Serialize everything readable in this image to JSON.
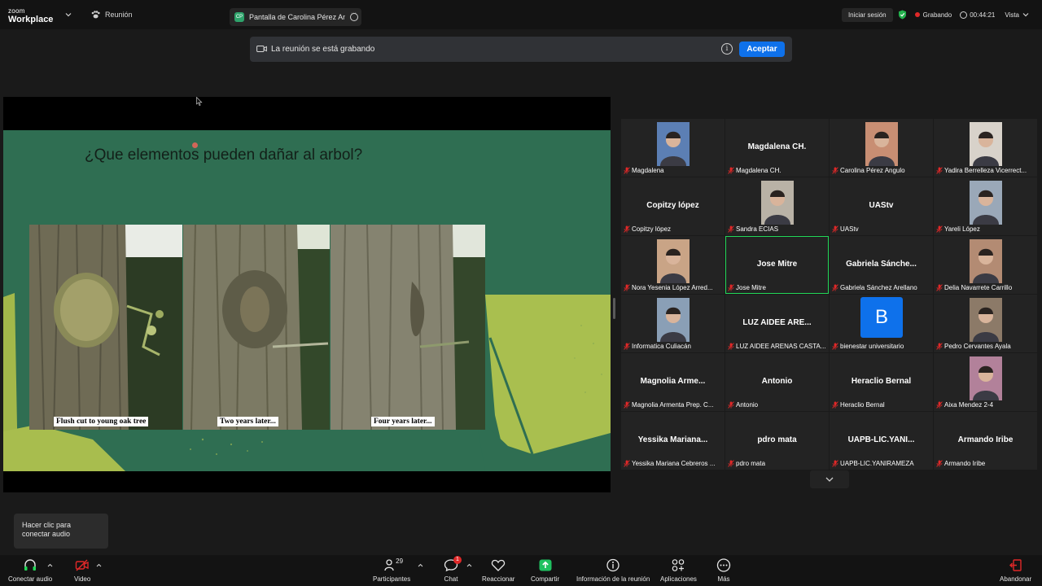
{
  "topbar": {
    "logo_small": "zoom",
    "logo_large": "Workplace",
    "meeting_label": "Reunión",
    "share_tab_badge": "CP",
    "share_tab_label": "Pantalla de Carolina Pérez Angulo",
    "signin": "Iniciar sesión",
    "recording": "Grabando",
    "timer": "00:44:21",
    "view": "Vista"
  },
  "banner": {
    "message": "La reunión se está grabando",
    "accept": "Aceptar"
  },
  "slide": {
    "title": "¿Que elementos pueden dañar al arbol?",
    "captions": [
      "Flush cut to young oak tree",
      "Two years later...",
      "Four years later..."
    ]
  },
  "gallery": {
    "tiles": [
      {
        "label": "Magdalena",
        "big": ""
      },
      {
        "label": "Magdalena CH.",
        "big": "Magdalena CH."
      },
      {
        "label": "Carolina Pérez Angulo",
        "big": ""
      },
      {
        "label": "Yadira Berrelleza Vicerrect...",
        "big": ""
      },
      {
        "label": "Copitzy lópez",
        "big": "Copitzy lópez"
      },
      {
        "label": "Sandra ECIAS",
        "big": ""
      },
      {
        "label": "UAStv",
        "big": "UAStv"
      },
      {
        "label": "Yareli López",
        "big": ""
      },
      {
        "label": "Nora Yesenia López Arred...",
        "big": ""
      },
      {
        "label": "Jose Mitre",
        "big": "Jose Mitre"
      },
      {
        "label": "Gabriela Sánchez Arellano",
        "big": "Gabriela  Sánche..."
      },
      {
        "label": "Delia Navarrete Carrillo",
        "big": ""
      },
      {
        "label": "Informatica Culiacán",
        "big": ""
      },
      {
        "label": "LUZ AIDEE ARENAS CASTA...",
        "big": "LUZ AIDEE ARE..."
      },
      {
        "label": "bienestar universitario",
        "big": ""
      },
      {
        "label": "Pedro Cervantes Ayala",
        "big": ""
      },
      {
        "label": "Magnolia Armenta Prep. C...",
        "big": "Magnolia  Arme..."
      },
      {
        "label": "Antonio",
        "big": "Antonio"
      },
      {
        "label": "Heraclio Bernal",
        "big": "Heraclio Bernal"
      },
      {
        "label": "Aixa Mendez 2-4",
        "big": ""
      },
      {
        "label": "Yessika Mariana Cebreros ...",
        "big": "Yessika  Mariana..."
      },
      {
        "label": "pdro mata",
        "big": "pdro mata"
      },
      {
        "label": "UAPB-LIC.YANIRAMEZA",
        "big": "UAPB-LIC.YANI..."
      },
      {
        "label": "Armando Iribe",
        "big": "Armando Iribe"
      }
    ],
    "avatar_letter": "B"
  },
  "tooltip": "Hacer clic para conectar audio",
  "toolbar": {
    "audio": "Conectar audio",
    "video": "Video",
    "participants": "Participantes",
    "participants_count": "29",
    "chat": "Chat",
    "chat_badge": "1",
    "react": "Reaccionar",
    "share": "Compartir",
    "info": "Información de la reunión",
    "apps": "Aplicaciones",
    "more": "Más",
    "leave": "Abandonar"
  },
  "colors": {
    "accent": "#0e71eb",
    "recording": "#e02828",
    "speaking": "#23d959",
    "share": "#1fc160",
    "slide_bg": "#2f6e52"
  }
}
